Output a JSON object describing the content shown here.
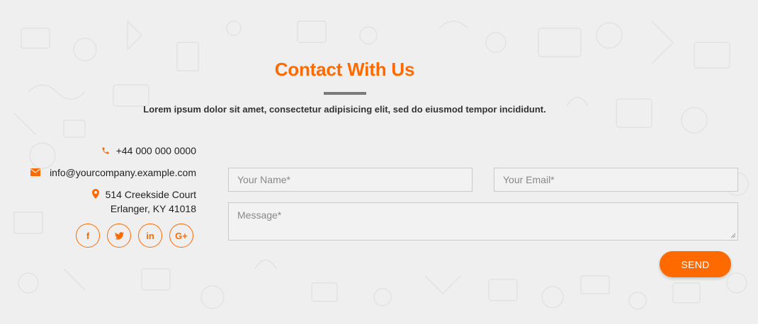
{
  "header": {
    "title": "Contact With Us",
    "subtitle": "Lorem ipsum dolor sit amet, consectetur adipisicing elit, sed do eiusmod tempor incididunt."
  },
  "contact": {
    "phone": "+44 000 000 0000",
    "email": "info@yourcompany.example.com",
    "address_line1": "514 Creekside Court",
    "address_line2": "Erlanger, KY 41018"
  },
  "social": [
    {
      "icon": "facebook-icon",
      "glyph": "f"
    },
    {
      "icon": "twitter-icon",
      "glyph": "t"
    },
    {
      "icon": "linkedin-icon",
      "glyph": "in"
    },
    {
      "icon": "google-plus-icon",
      "glyph": "G+"
    }
  ],
  "form": {
    "name_placeholder": "Your Name*",
    "email_placeholder": "Your Email*",
    "message_placeholder": "Message*",
    "name_value": "",
    "email_value": "",
    "message_value": "",
    "send_label": "SEND"
  },
  "colors": {
    "accent": "#ff6a00",
    "background": "#efefef",
    "divider": "#7a7a7a"
  }
}
